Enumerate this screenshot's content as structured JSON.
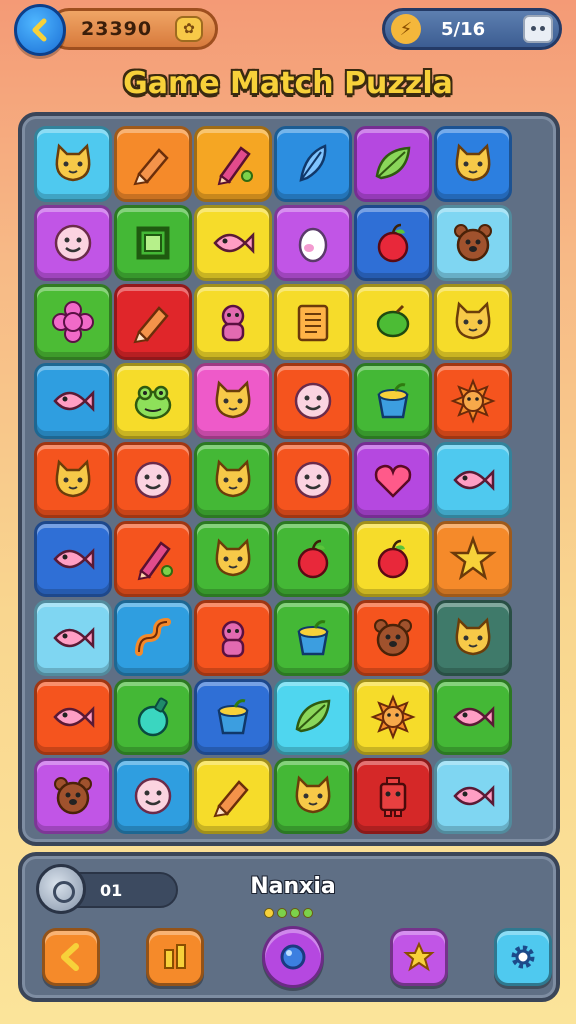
{
  "header": {
    "coins": "23390",
    "energy": "5/16",
    "icons": {
      "back": "back-arrow-icon",
      "coin": "coin-icon",
      "energy": "lightning-icon",
      "profile": "robot-icon"
    }
  },
  "title": "Game Match Puzzla",
  "board": {
    "rows": [
      [
        {
          "icon": "cat-face",
          "bg": "#4fc9ef"
        },
        {
          "icon": "crayon",
          "bg": "#f58a2a"
        },
        {
          "icon": "pencil",
          "bg": "#f5a623"
        },
        {
          "icon": "feather",
          "bg": "#2c8ee0"
        },
        {
          "icon": "leaf",
          "bg": "#b548e0"
        },
        {
          "icon": "cat-face",
          "bg": "#2c7fe0"
        }
      ],
      [
        {
          "icon": "smiley",
          "bg": "#c155e6"
        },
        {
          "icon": "frame",
          "bg": "#44b836"
        },
        {
          "icon": "fish",
          "bg": "#f6dc2a"
        },
        {
          "icon": "egg",
          "bg": "#c155e6"
        },
        {
          "icon": "apple",
          "bg": "#2f6fd6"
        },
        {
          "icon": "bear-face",
          "bg": "#7fd6f2"
        }
      ],
      [
        {
          "icon": "flower",
          "bg": "#4cbc35"
        },
        {
          "icon": "crayon",
          "bg": "#e0262a"
        },
        {
          "icon": "monkey",
          "bg": "#f6dc2a"
        },
        {
          "icon": "notebook",
          "bg": "#f6dc2a"
        },
        {
          "icon": "lemon",
          "bg": "#f6dc2a"
        },
        {
          "icon": "cat-face",
          "bg": "#f6dc2a"
        }
      ],
      [
        {
          "icon": "fish",
          "bg": "#2f9ee0"
        },
        {
          "icon": "frog",
          "bg": "#f6dc2a"
        },
        {
          "icon": "cat-face",
          "bg": "#ee5ac9"
        },
        {
          "icon": "smiley",
          "bg": "#f5541e"
        },
        {
          "icon": "cup",
          "bg": "#44b836"
        },
        {
          "icon": "sun",
          "bg": "#f5541e"
        }
      ],
      [
        {
          "icon": "cat-face",
          "bg": "#f5541e"
        },
        {
          "icon": "smiley",
          "bg": "#f5541e"
        },
        {
          "icon": "cat-face",
          "bg": "#44b836"
        },
        {
          "icon": "smiley",
          "bg": "#f5541e"
        },
        {
          "icon": "heart",
          "bg": "#b548e0"
        },
        {
          "icon": "fish",
          "bg": "#4fc9ef"
        }
      ],
      [
        {
          "icon": "fish",
          "bg": "#2f6fd6"
        },
        {
          "icon": "pencil",
          "bg": "#f5541e"
        },
        {
          "icon": "cat-face",
          "bg": "#44b836"
        },
        {
          "icon": "apple",
          "bg": "#44b836"
        },
        {
          "icon": "apple",
          "bg": "#f6dc2a"
        },
        {
          "icon": "star",
          "bg": "#f58a2a"
        }
      ],
      [
        {
          "icon": "fish",
          "bg": "#7fd6f2"
        },
        {
          "icon": "worm",
          "bg": "#2f9ee0"
        },
        {
          "icon": "monkey",
          "bg": "#f5541e"
        },
        {
          "icon": "cup",
          "bg": "#44b836"
        },
        {
          "icon": "bear-face",
          "bg": "#f5541e"
        },
        {
          "icon": "cat-face",
          "bg": "#3f7a6a"
        }
      ],
      [
        {
          "icon": "fish",
          "bg": "#f5541e"
        },
        {
          "icon": "bottle",
          "bg": "#44b836"
        },
        {
          "icon": "cup",
          "bg": "#2f6fd6"
        },
        {
          "icon": "leaf",
          "bg": "#4fd6ef"
        },
        {
          "icon": "sun",
          "bg": "#f6dc2a"
        },
        {
          "icon": "fish",
          "bg": "#44b836"
        }
      ],
      [
        {
          "icon": "bear-face",
          "bg": "#c155e6"
        },
        {
          "icon": "smiley",
          "bg": "#2f9ee0"
        },
        {
          "icon": "crayon",
          "bg": "#f6dc2a"
        },
        {
          "icon": "cat-face",
          "bg": "#44b836"
        },
        {
          "icon": "robot",
          "bg": "#d52828"
        },
        {
          "icon": "fish",
          "bg": "#7fd6f2"
        }
      ]
    ]
  },
  "panel": {
    "player_level": "01",
    "player_name": "Nanxia",
    "buttons": [
      {
        "name": "back-button",
        "icon": "back-arrow-icon",
        "bg": "#f58a2a"
      },
      {
        "name": "stats-button",
        "icon": "bars-icon",
        "bg": "#f58a2a"
      },
      {
        "name": "center-orb-button",
        "icon": "orb-icon",
        "bg": "#b548e0"
      },
      {
        "name": "star-button",
        "icon": "star-icon",
        "bg": "#c155e6"
      },
      {
        "name": "settings-button",
        "icon": "gear-icon",
        "bg": "#4fc9ef"
      }
    ]
  }
}
